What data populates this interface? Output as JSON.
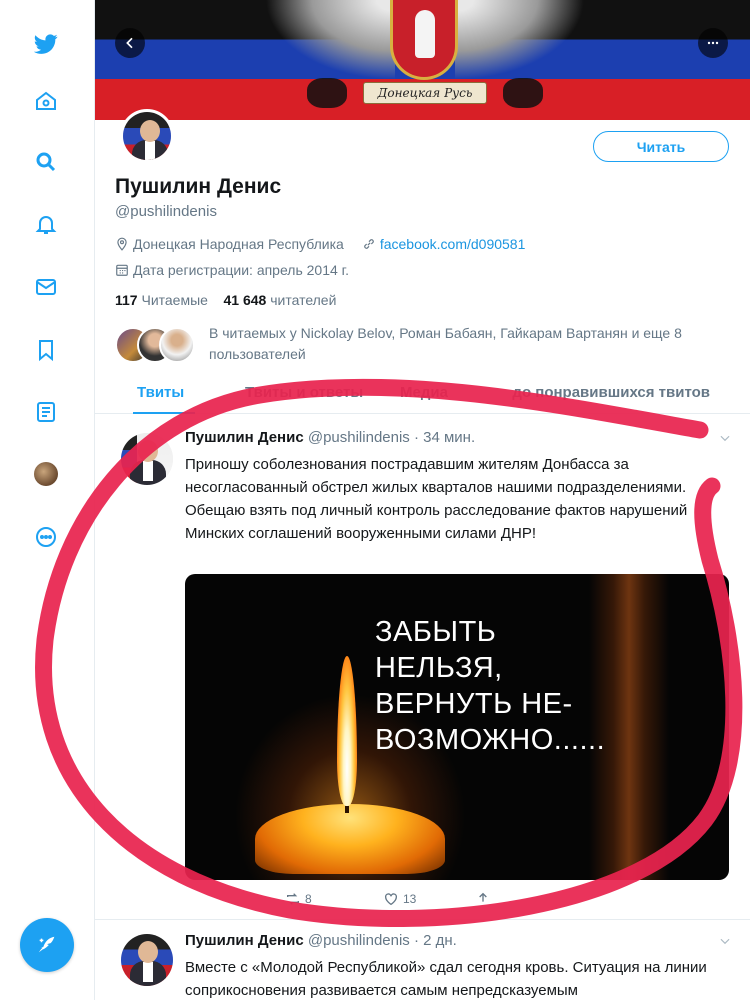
{
  "sidebar": {
    "items": [
      {
        "icon": "twitter-bird-icon"
      },
      {
        "icon": "home-icon"
      },
      {
        "icon": "search-icon"
      },
      {
        "icon": "bell-icon"
      },
      {
        "icon": "envelope-icon"
      },
      {
        "icon": "bookmark-icon"
      },
      {
        "icon": "list-icon"
      },
      {
        "icon": "profile-avatar-icon"
      },
      {
        "icon": "more-circle-icon"
      }
    ],
    "compose_icon": "compose-tweet-icon",
    "accent_color": "#1da1f2"
  },
  "banner": {
    "ribbon_text": "Донецкая Русь"
  },
  "profile": {
    "follow_label": "Читать",
    "name": "Пушилин Денис",
    "handle": "@pushilindenis",
    "location": "Донецкая Народная Республика",
    "website": "facebook.com/d090581",
    "joined": "Дата регистрации: апрель 2014 г.",
    "following_count": "117",
    "following_label": "Читаемые",
    "followers_count": "41 648",
    "followers_label": "читателей",
    "followed_by": "В читаемых у Nickolay Belov, Роман Бабаян, Гайкарам Вартанян и еще 8 пользователей"
  },
  "tabs": [
    {
      "label": "Твиты"
    },
    {
      "label": "Твиты и ответы"
    },
    {
      "label": "Медиа"
    },
    {
      "label": "Отметки «Нравится» до понравившихся твитов"
    }
  ],
  "tweets": [
    {
      "name": "Пушилин Денис",
      "handle": "@pushilindenis",
      "time": "· 34 мин.",
      "text": "Приношу соболезнования пострадавшим жителям Донбасса за несогласованный обстрел жилых кварталов нашими подразделениями. Обещаю взять под личный контроль расследование фактов нарушений Минских соглашений вооруженными силами ДНР!",
      "media_text_lines": [
        "ЗАБЫТЬ",
        "НЕЛЬЗЯ,",
        "ВЕРНУТЬ НЕ-",
        "ВОЗМОЖНО......"
      ],
      "retweets": "8",
      "likes": "13"
    },
    {
      "name": "Пушилин Денис",
      "handle": "@pushilindenis",
      "time": "· 2 дн.",
      "text": "Вместе с «Молодой Республикой» сдал сегодня кровь. Ситуация на линии соприкосновения развивается самым непредсказуемым"
    }
  ],
  "annotation_color": "#e8234f"
}
